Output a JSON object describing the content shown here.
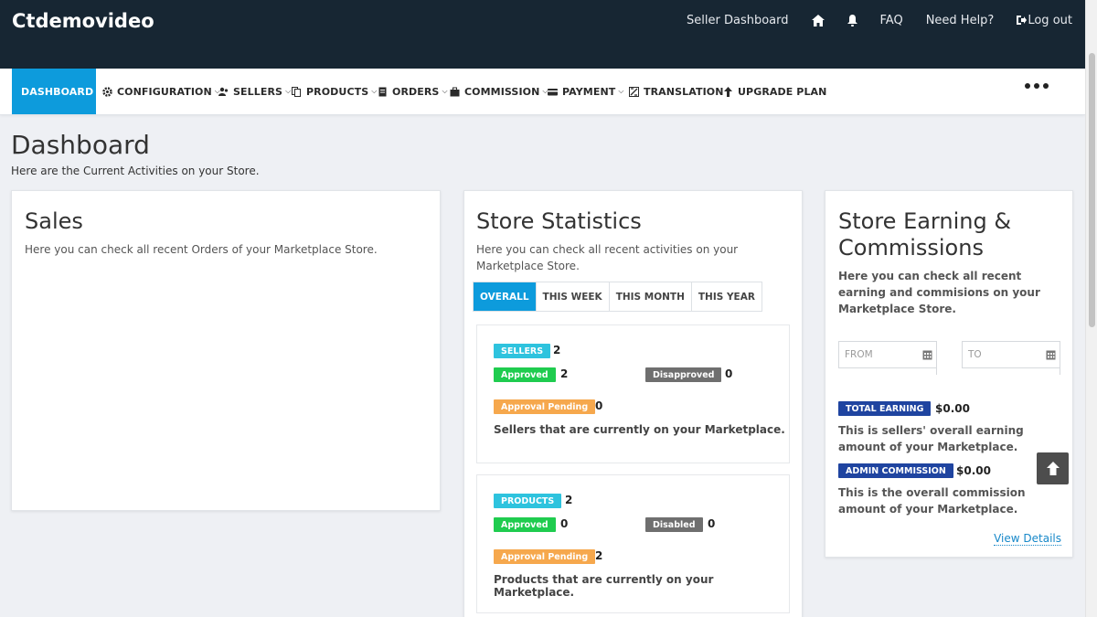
{
  "header": {
    "brand": "Ctdemovideo",
    "links": {
      "seller_dashboard": "Seller Dashboard",
      "faq": "FAQ",
      "need_help": "Need Help?",
      "logout": "Log out"
    },
    "icons": [
      "home-icon",
      "bell-icon",
      "logout-icon"
    ]
  },
  "nav": {
    "items": [
      {
        "label": "DASHBOARD",
        "icon": "dashboard-icon",
        "active": true
      },
      {
        "label": "CONFIGURATION",
        "icon": "gear-icon",
        "dropdown": true
      },
      {
        "label": "SELLERS",
        "icon": "users-icon",
        "dropdown": true
      },
      {
        "label": "PRODUCTS",
        "icon": "copy-icon",
        "dropdown": true
      },
      {
        "label": "ORDERS",
        "icon": "file-icon",
        "dropdown": true
      },
      {
        "label": "COMMISSION",
        "icon": "briefcase-icon",
        "dropdown": true
      },
      {
        "label": "PAYMENT",
        "icon": "card-icon",
        "dropdown": true
      },
      {
        "label": "TRANSLATION",
        "icon": "translate-icon"
      },
      {
        "label": "UPGRADE PLAN",
        "icon": "upgrade-icon"
      }
    ],
    "more_icon": "more-dots-icon"
  },
  "page": {
    "title": "Dashboard",
    "subtitle": "Here are the Current Activities on your Store."
  },
  "sales": {
    "title": "Sales",
    "description": "Here you can check all recent Orders of your Marketplace Store."
  },
  "stats": {
    "title": "Store Statistics",
    "description": "Here you can check all recent activities on your Marketplace Store.",
    "tabs": [
      "OVERALL",
      "THIS WEEK",
      "THIS MONTH",
      "THIS YEAR"
    ],
    "active_tab": "OVERALL",
    "sellers": {
      "label": "SELLERS",
      "count": "2",
      "approved_label": "Approved",
      "approved": "2",
      "disapproved_label": "Disapproved",
      "disapproved": "0",
      "pending_label": "Approval Pending",
      "pending": "0",
      "note": "Sellers that are currently on your Marketplace."
    },
    "products": {
      "label": "PRODUCTS",
      "count": "2",
      "approved_label": "Approved",
      "approved": "0",
      "disabled_label": "Disabled",
      "disabled": "0",
      "pending_label": "Approval Pending",
      "pending": "2",
      "note": "Products that are currently on your Marketplace."
    }
  },
  "earnings": {
    "title": "Store Earning & Commissions",
    "description": "Here you can check all recent earning and commisions on your Marketplace Store.",
    "from_placeholder": "FROM",
    "to_placeholder": "TO",
    "total_label": "TOTAL EARNING",
    "total_value": "$0.00",
    "total_note": "This is sellers' overall earning amount of your Marketplace.",
    "admin_label": "ADMIN COMMISSION",
    "admin_value": "$0.00",
    "admin_note": "This is the overall commission amount of your Marketplace.",
    "view_details": "View Details"
  },
  "colors": {
    "topbar": "#172633",
    "accent": "#0d9bdc",
    "cyan": "#2ec3de",
    "green": "#1fcc4f",
    "gray": "#6f6f6f",
    "orange": "#f6a84d",
    "navy": "#1f44a0"
  }
}
